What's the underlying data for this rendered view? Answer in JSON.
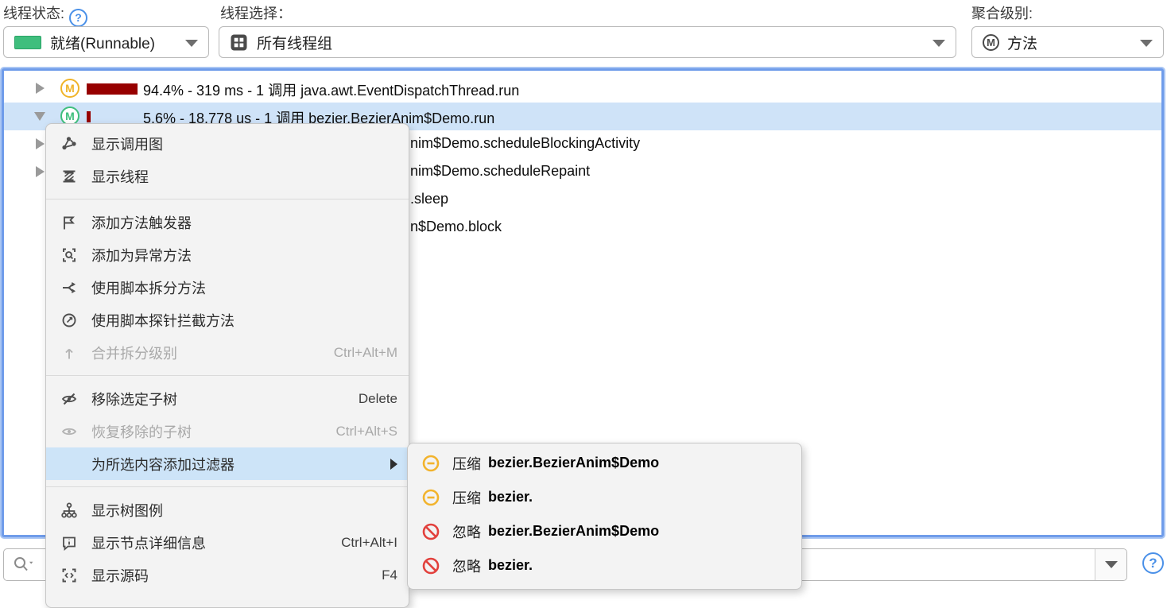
{
  "header": {
    "thread_state_label": "线程状态:",
    "thread_state_value": "就绪(Runnable)",
    "thread_select_label": "线程选择：",
    "thread_select_value": "所有线程组",
    "aggregation_label": "聚合级别:",
    "aggregation_value": "方法",
    "aggregation_badge": "M"
  },
  "tree": {
    "rows": [
      {
        "badge": "M",
        "text": "94.4% - 319 ms - 1 调用 java.awt.EventDispatchThread.run"
      },
      {
        "badge": "M",
        "text": "5.6% - 18,778 us - 1 调用 bezier.BezierAnim$Demo.run",
        "selected": true
      },
      {
        "text": "nim$Demo.scheduleBlockingActivity"
      },
      {
        "text": "nim$Demo.scheduleRepaint"
      },
      {
        "text": ".sleep"
      },
      {
        "text": "n$Demo.block"
      }
    ]
  },
  "menu": {
    "items": [
      {
        "label": "显示调用图",
        "shortcut": "",
        "icon": "call-graph"
      },
      {
        "label": "显示线程",
        "shortcut": "",
        "icon": "threads"
      },
      {
        "label": "添加方法触发器",
        "shortcut": "",
        "icon": "flag"
      },
      {
        "label": "添加为异常方法",
        "shortcut": "",
        "icon": "exception-scan"
      },
      {
        "label": "使用脚本拆分方法",
        "shortcut": "",
        "icon": "split"
      },
      {
        "label": "使用脚本探针拦截方法",
        "shortcut": "",
        "icon": "probe"
      },
      {
        "label": "合并拆分级别",
        "shortcut": "Ctrl+Alt+M",
        "icon": "merge",
        "disabled": true
      },
      {
        "label": "移除选定子树",
        "shortcut": "Delete",
        "icon": "eye-off"
      },
      {
        "label": "恢复移除的子树",
        "shortcut": "Ctrl+Alt+S",
        "icon": "eye",
        "disabled": true
      },
      {
        "label": "为所选内容添加过滤器",
        "shortcut": "",
        "icon": "",
        "submenu": true,
        "highlighted": true
      },
      {
        "label": "显示树图例",
        "shortcut": "",
        "icon": "tree-legend"
      },
      {
        "label": "显示节点详细信息",
        "shortcut": "Ctrl+Alt+I",
        "icon": "node-info"
      },
      {
        "label": "显示源码",
        "shortcut": "F4",
        "icon": "source-code"
      }
    ]
  },
  "submenu": {
    "items": [
      {
        "action": "压缩",
        "target": "bezier.BezierAnim$Demo",
        "icon": "circle-minus"
      },
      {
        "action": "压缩",
        "target": "bezier.",
        "icon": "circle-minus"
      },
      {
        "action": "忽略",
        "target": "bezier.BezierAnim$Demo",
        "icon": "circle-slash"
      },
      {
        "action": "忽略",
        "target": "bezier.",
        "icon": "circle-slash"
      }
    ]
  },
  "search": {
    "value": ""
  },
  "icons": {
    "help": "question-mark-circle",
    "thread_groups": "grid-2x2",
    "aggregation": "circled-M",
    "compress": "yellow circle with minus",
    "ignore": "red prohibition circle"
  },
  "colors": {
    "selection_blue": "#cfe3f8",
    "focus_border_blue": "#6f9cea",
    "time_bar_red": "#970000",
    "runnable_green": "#3fbe7d",
    "method_badge_yellow": "#f0b429",
    "help_blue": "#4a90e8",
    "menu_bg": "#f3f3f3",
    "warn_yellow": "#f2b32c",
    "error_red": "#e2403c"
  }
}
